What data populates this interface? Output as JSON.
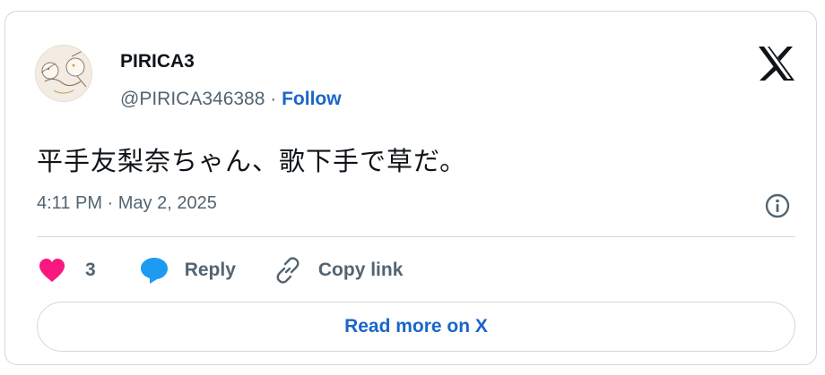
{
  "user": {
    "name": "PIRICA3",
    "handle": "@PIRICA346388",
    "separator": "·",
    "follow_label": "Follow"
  },
  "tweet": {
    "text": "平手友梨奈ちゃん、歌下手で草だ。",
    "timestamp": "4:11 PM · May 2, 2025"
  },
  "actions": {
    "like_count": "3",
    "reply_label": "Reply",
    "copy_label": "Copy link"
  },
  "read_more_label": "Read more on X",
  "colors": {
    "like": "#f91880",
    "reply": "#1d9bf0",
    "link": "#1a66c8",
    "text": "#0f1419",
    "muted": "#536471",
    "border": "#cfd9de"
  },
  "icons": [
    "x-logo-icon",
    "info-icon",
    "heart-icon",
    "reply-bubble-icon",
    "link-icon"
  ]
}
